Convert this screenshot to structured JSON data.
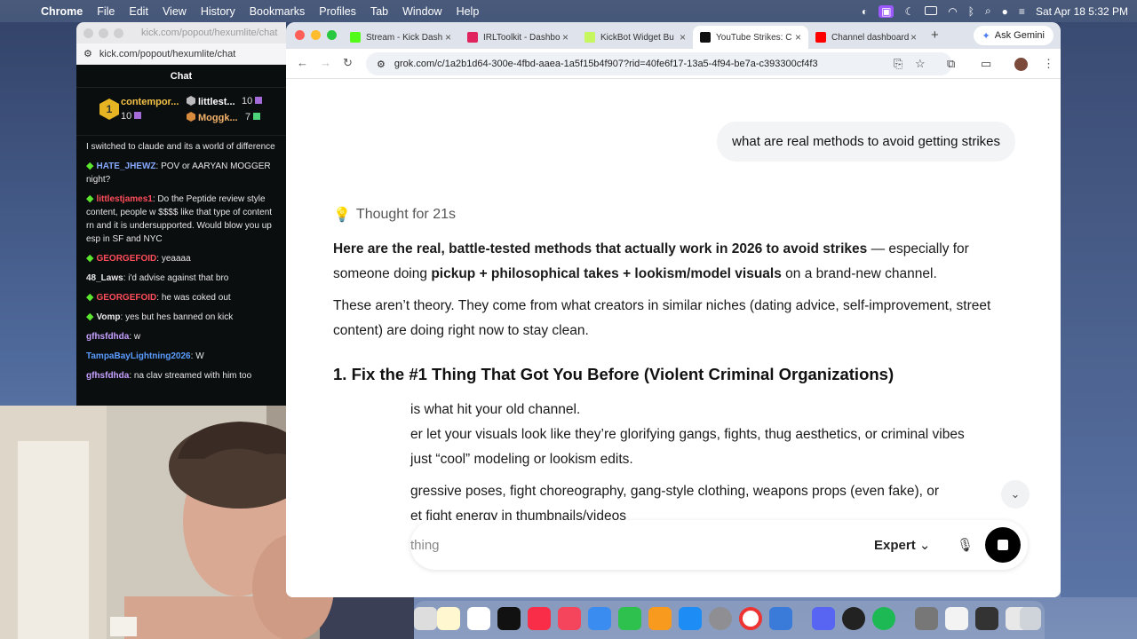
{
  "menubar": {
    "app": "Chrome",
    "items": [
      "File",
      "Edit",
      "View",
      "History",
      "Bookmarks",
      "Profiles",
      "Tab",
      "Window",
      "Help"
    ],
    "datetime": "Sat Apr 18  5:32 PM"
  },
  "chat_window": {
    "title_url": "kick.com/popout/hexumlite/chat",
    "address": "kick.com/popout/hexumlite/chat",
    "header": "Chat",
    "leaderboard": {
      "rank": "1",
      "first_name": "contempor...",
      "first_points": "10",
      "second_name": "littlest...",
      "second_points": "10",
      "third_name": "Moggk...",
      "third_points": "7"
    },
    "messages": [
      {
        "user": "",
        "text": "I switched to claude and its a world of difference",
        "color": "white",
        "badge": false
      },
      {
        "user": "HATE_JHEWZ",
        "text": "POV or AARYAN MOGGER night?",
        "color": "blue",
        "badge": true
      },
      {
        "user": "littlestjames1",
        "text": "Do the Peptide review style content, people w $$$$ like that type of content rn and it is undersupported. Would blow you up esp in SF and NYC",
        "color": "red",
        "badge": true
      },
      {
        "user": "GEORGEFOID",
        "text": "yeaaaa",
        "color": "red",
        "badge": true
      },
      {
        "user": "48_Laws",
        "text": "i'd advise against that bro",
        "color": "white",
        "badge": false
      },
      {
        "user": "GEORGEFOID",
        "text": "he was coked out",
        "color": "red",
        "badge": true
      },
      {
        "user": "Vomp",
        "text": "yes but hes banned on kick",
        "color": "white",
        "badge": true
      },
      {
        "user": "gfhsfdhda",
        "text": "w",
        "color": "purple",
        "badge": false
      },
      {
        "user": "TampaBayLightning2026",
        "text": "W",
        "color": "cyan",
        "badge": false
      },
      {
        "user": "gfhsfdhda",
        "text": "na clav streamed with him too",
        "color": "purple",
        "badge": false
      }
    ]
  },
  "browser": {
    "tabs": [
      {
        "label": "Stream - Kick Dash",
        "color": "#53fc18"
      },
      {
        "label": "IRLToolkit - Dashbo",
        "color": "#e0245e"
      },
      {
        "label": "KickBot Widget Bu",
        "color": "#c6f75e"
      },
      {
        "label": "YouTube Strikes: C",
        "color": "#111111"
      },
      {
        "label": "Channel dashboard",
        "color": "#ff0000"
      }
    ],
    "ask_gemini": "Ask Gemini",
    "url": "grok.com/c/1a2b1d64-300e-4fbd-aaea-1a5f15b4f907?rid=40fe6f17-13a5-4f94-be7a-c393300cf4f3"
  },
  "conversation": {
    "user_prompt": "what are real methods to avoid getting strikes",
    "thought": "Thought for 21s",
    "intro_bold": "Here are the real, battle-tested methods that actually work in 2026 to avoid strikes",
    "intro_rest": " — especially for someone doing ",
    "intro_bold2": "pickup + philosophical takes + lookism/model visuals",
    "intro_end": " on a brand-new channel.",
    "para2": "These aren’t theory. They come from what creators in similar niches (dating advice, self-improvement, street content) are doing right now to stay clean.",
    "heading": "1. Fix the #1 Thing That Got You Before (Violent Criminal Organizations)",
    "line1": "is what hit your old channel.",
    "line2": "er let your visuals look like they’re glorifying gangs, fights, thug aesthetics, or criminal vibes",
    "line3": "just “cool” modeling or lookism edits.",
    "line4": "gressive poses, fight choreography, gang-style clothing, weapons props (even fake), or",
    "line5": "et fight energy in thumbnails/videos"
  },
  "composer": {
    "placeholder": "thing",
    "mode": "Expert"
  }
}
